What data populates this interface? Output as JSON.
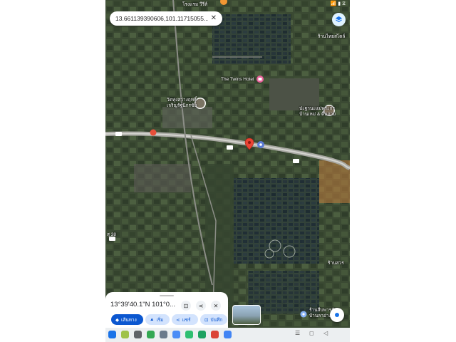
{
  "status_bar": {
    "time": "",
    "icons_right": "📶 ▮ ⧖"
  },
  "search_pill": {
    "coords": "13.661139390606,101.11715055...",
    "close": "✕"
  },
  "map_labels": {
    "top_place": "โรงแรม วีรีส์",
    "twin_hotel": "The Twins Hotel",
    "temple_line1": "วัดทุ่งสว่างฤทธิ์",
    "temple_line2": "เจริญรัฐนิกรชัย",
    "right_place_line1": "ปะฐานะแม่พระกร",
    "right_place_line2": "บ้านเหม่ & ตื่นถวย",
    "top_right": "ร้านไทยสไตล์",
    "bottom_right_line1": "ร้านสีบพารกัน",
    "bottom_right_line2": "บ้านลาอ่าง",
    "left_route": "สุ 38",
    "bottom_right2": "ร้านสวร"
  },
  "sheet": {
    "title": "13°39'40.1\"N 101°0...",
    "save_icon": "⊡",
    "share_icon": "⋖",
    "close_icon": "✕",
    "chips": {
      "directions": "เส้นทาง",
      "start": "เริ่ม",
      "share": "แชร์",
      "save": "บันทึก"
    }
  },
  "nav": {
    "menu": "☰",
    "home": "◻",
    "back": "◁"
  },
  "colors": {
    "accent": "#0b57d0",
    "pin": "#ea4335",
    "map_bg": "#2b3a2c"
  }
}
